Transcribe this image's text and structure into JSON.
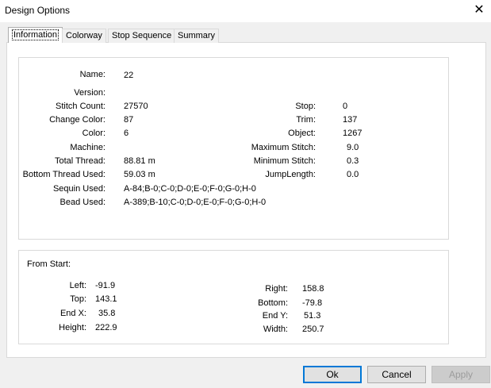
{
  "window": {
    "title": "Design Options",
    "close_glyph": "✕"
  },
  "tabs": [
    {
      "label": "Information",
      "active": true
    },
    {
      "label": "Colorway"
    },
    {
      "label": "Stop Sequence"
    },
    {
      "label": "Summary"
    }
  ],
  "info": {
    "name_label": "Name:",
    "name_value": "22",
    "version_label": "Version:",
    "version_value": "",
    "stitch_count_label": "Stitch Count:",
    "stitch_count_value": "27570",
    "change_color_label": "Change Color:",
    "change_color_value": "87",
    "color_label": "Color:",
    "color_value": "6",
    "machine_label": "Machine:",
    "machine_value": "",
    "total_thread_label": "Total Thread:",
    "total_thread_value": "88.81 m",
    "bottom_thread_label": "Bottom Thread Used:",
    "bottom_thread_value": "59.03 m",
    "sequin_label": "Sequin Used:",
    "sequin_value": "A-84;B-0;C-0;D-0;E-0;F-0;G-0;H-0",
    "bead_label": "Bead Used:",
    "bead_value": "A-389;B-10;C-0;D-0;E-0;F-0;G-0;H-0",
    "stop_label": "Stop:",
    "stop_value": "0",
    "trim_label": "Trim:",
    "trim_value": "137",
    "object_label": "Object:",
    "object_value": "1267",
    "max_stitch_label": "Maximum Stitch:",
    "max_stitch_value": "9.0",
    "min_stitch_label": "Minimum Stitch:",
    "min_stitch_value": "0.3",
    "jump_label": "JumpLength:",
    "jump_value": "0.0"
  },
  "from_start": {
    "heading": "From Start:",
    "left_label": "Left:",
    "left_value": "-91.9",
    "top_label": "Top:",
    "top_value": "143.1",
    "endx_label": "End X:",
    "endx_value": "35.8",
    "height_label": "Height:",
    "height_value": "222.9",
    "right_label": "Right:",
    "right_value": "158.8",
    "bottom_label": "Bottom:",
    "bottom_value": "-79.8",
    "endy_label": "End Y:",
    "endy_value": "51.3",
    "width_label": "Width:",
    "width_value": "250.7"
  },
  "buttons": {
    "ok": "Ok",
    "cancel": "Cancel",
    "apply": "Apply"
  }
}
